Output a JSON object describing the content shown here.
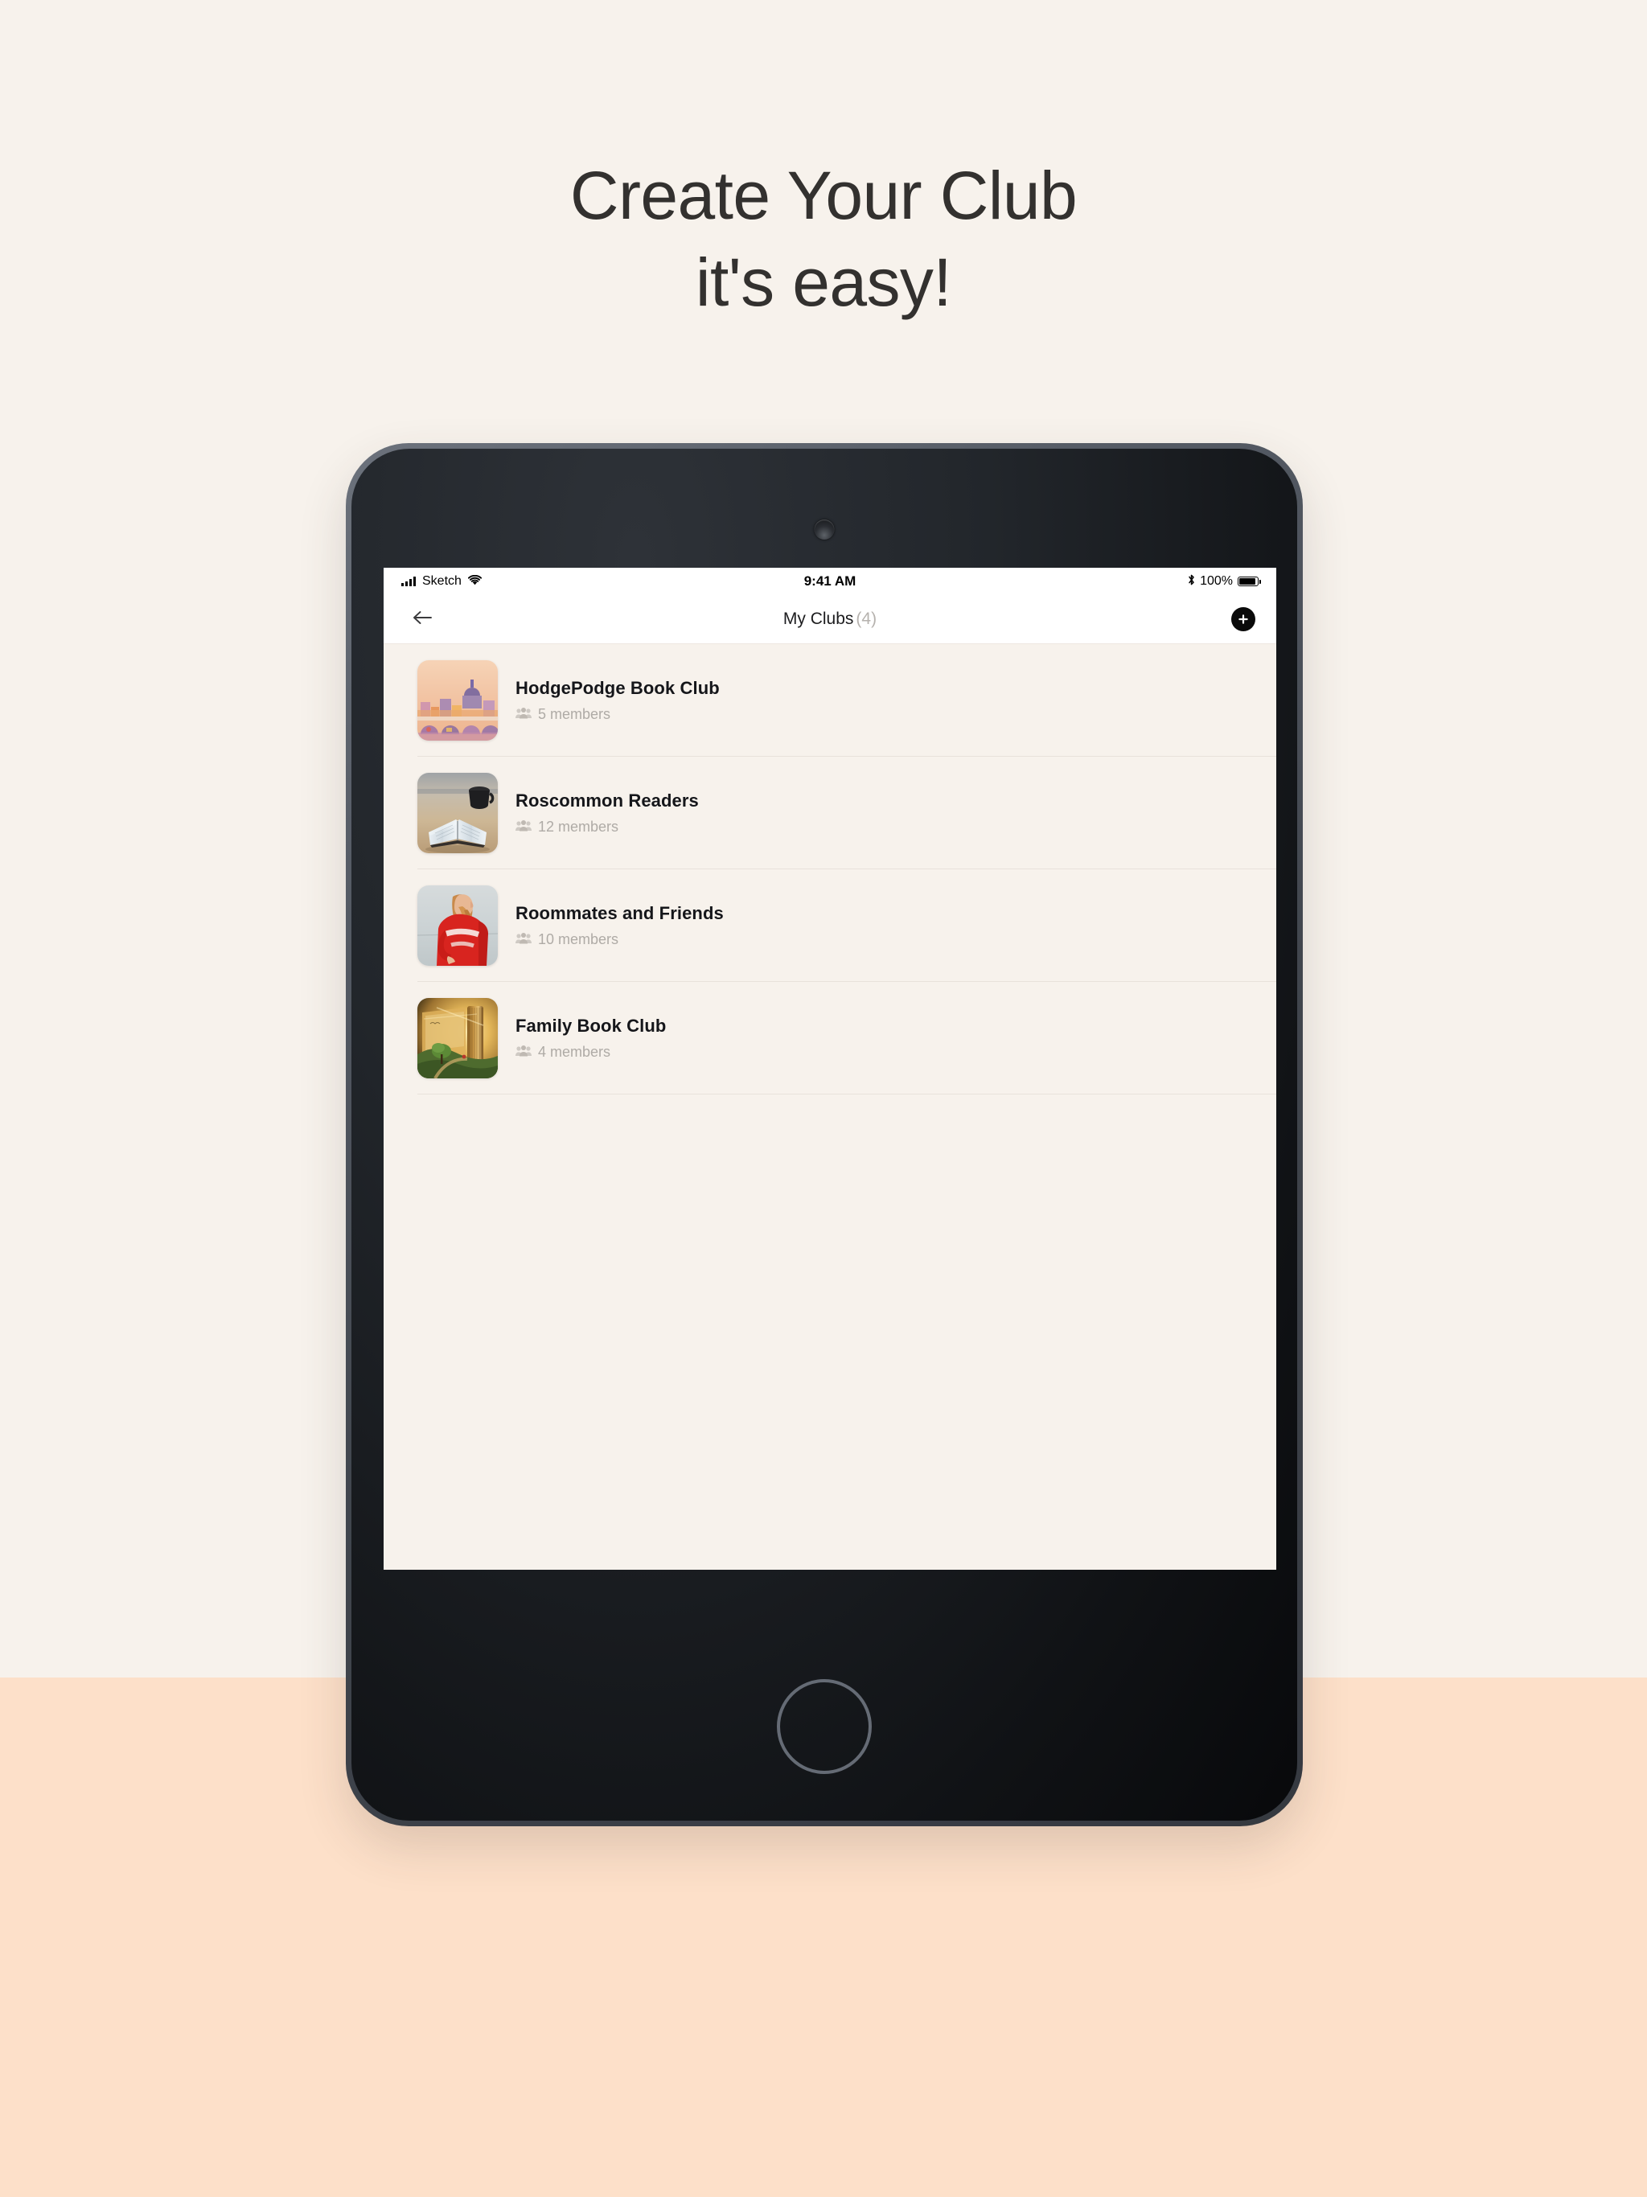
{
  "page": {
    "background_cream": "#F7F2EC",
    "background_peach": "#FDE0C9",
    "headline_line1": "Create Your Club",
    "headline_line2": "it's easy!"
  },
  "device": {
    "bezel_color": "#41464E",
    "screen_background": "#F7F2EC"
  },
  "status_bar": {
    "carrier": "Sketch",
    "time": "9:41 AM",
    "battery_percent": "100%",
    "signal_icon": "cellular-signal-icon",
    "wifi_icon": "wifi-icon",
    "bluetooth_icon": "bluetooth-icon",
    "battery_icon": "battery-full-icon"
  },
  "nav_bar": {
    "back_icon": "back-arrow-icon",
    "title": "My Clubs",
    "count": "(4)",
    "add_icon": "plus-circle-icon",
    "add_button_color": "#0A0A0A"
  },
  "clubs": [
    {
      "name": "HodgePodge Book Club",
      "members": "5 members",
      "thumbnail": "watercolor-rome-cityscape",
      "thumb_colors": [
        "#F3C9A8",
        "#E8A7A0",
        "#B98FC0",
        "#F0B25E",
        "#8E6FA8"
      ]
    },
    {
      "name": "Roscommon Readers",
      "members": "12 members",
      "thumbnail": "open-book-with-coffee-mug",
      "thumb_colors": [
        "#C9B79E",
        "#DDE6EC",
        "#2A2A2C",
        "#A88C66"
      ]
    },
    {
      "name": "Roommates and Friends",
      "members": "10 members",
      "thumbnail": "woman-in-red-tomato-soup-sweatshirt",
      "thumb_colors": [
        "#CFD6D8",
        "#D8241F",
        "#C98A4B",
        "#FFFFFF"
      ]
    },
    {
      "name": "Family Book Club",
      "members": "4 members",
      "thumbnail": "glowing-open-book-landscape",
      "thumb_colors": [
        "#D9A43E",
        "#6E4A1E",
        "#4E6B2E",
        "#F2D58A"
      ]
    }
  ],
  "members_icon_name": "people-group-icon",
  "members_icon_color": "#CFCAC4"
}
